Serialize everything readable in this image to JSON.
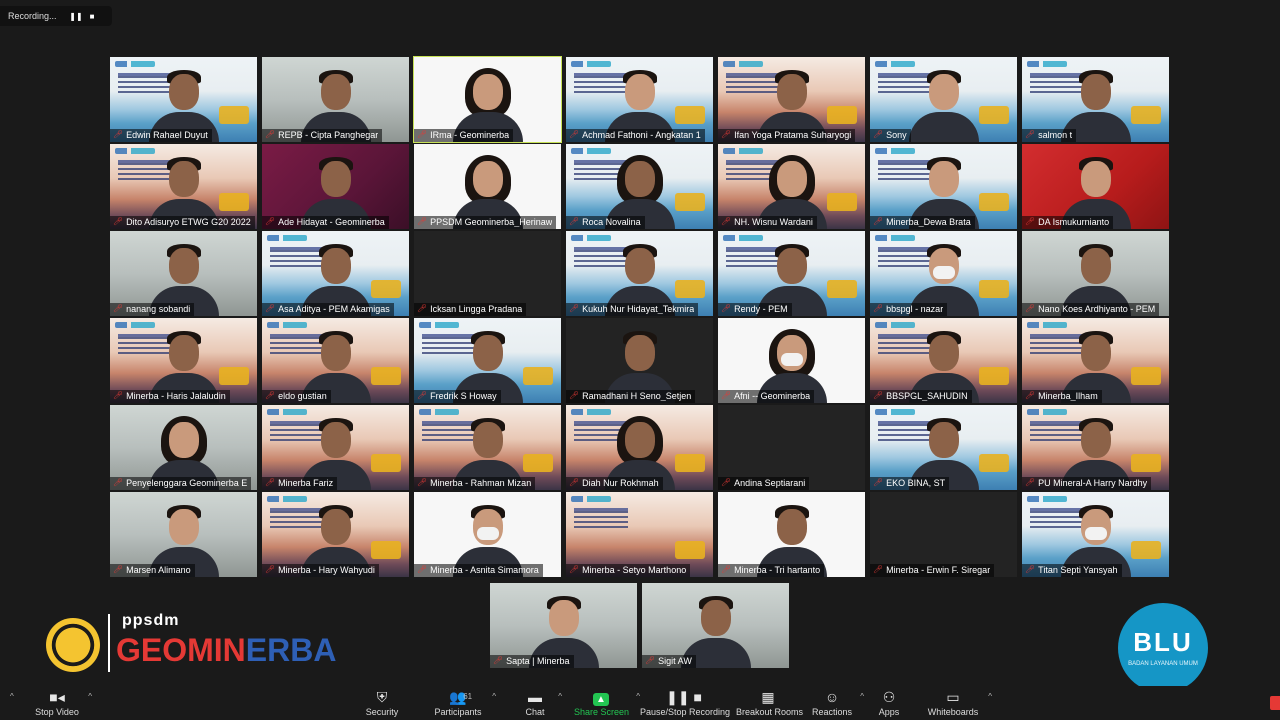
{
  "recording": {
    "label": "Recording...",
    "pause_icon": "pause-icon",
    "stop_icon": "stop-icon"
  },
  "colors": {
    "active_speaker": "#c7e256",
    "mic_muted": "#e53935",
    "share_green": "#23c552",
    "blu_blue": "#1596c6"
  },
  "participants": [
    "Edwin Rahael Duyut",
    "REPB - Cipta Panghegar",
    "IRma - Geominerba",
    "Achmad Fathoni - Angkatan 1",
    "Ifan Yoga Pratama Suharyogi",
    "Sony",
    "salmon t",
    "Dito Adisuryo ETWG G20 2022",
    "Ade Hidayat - Geominerba",
    "PPSDM Geominerba_Herinaw",
    "Roca Novalina",
    "NH. Wisnu Wardani",
    "Minerba_Dewa Brata",
    "DA Ismukurnianto",
    "nanang sobandi",
    "Asa Aditya - PEM Akamigas",
    "Icksan Lingga Pradana",
    "Kukuh Nur Hidayat_Tekmira",
    "Rendy - PEM",
    "bbspgl - nazar",
    "Nano Koes Ardhiyanto - PEM",
    "Minerba - Haris Jalaludin",
    "eldo gustian",
    "Fredrik S Howay",
    "Ramadhani H Seno_Setjen",
    "Afni -- Geominerba",
    "BBSPGL_SAHUDIN",
    "Minerba_Ilham",
    "Penyelenggara Geominerba E",
    "Minerba Fariz",
    "Minerba - Rahman Mizan",
    "Diah Nur Rokhmah",
    "Andina Septiarani",
    "EKO BINA, ST",
    "PU Mineral-A Harry Nardhy",
    "Marsen Alimano",
    "Minerba - Hary Wahyudi",
    "Minerba - Asnita Simamora",
    "Minerba - Setyo Marthono",
    "Minerba - Tri hartanto",
    "Minerba - Erwin F. Siregar",
    "Titan Septi Yansyah",
    "Sapta | Minerba",
    "Sigit AW"
  ],
  "brand": {
    "sub": "ppsdm",
    "main_a": "GEOMIN",
    "main_b": "ERBA"
  },
  "blu": {
    "title": "BLU",
    "subtitle": "BADAN LAYANAN UMUM"
  },
  "toolbar": {
    "stop_video": "Stop Video",
    "security": "Security",
    "participants": "Participants",
    "participants_count": "61",
    "chat": "Chat",
    "share_screen": "Share Screen",
    "pause_recording": "Pause/Stop Recording",
    "breakout_rooms": "Breakout Rooms",
    "reactions": "Reactions",
    "apps": "Apps",
    "whiteboards": "Whiteboards"
  }
}
